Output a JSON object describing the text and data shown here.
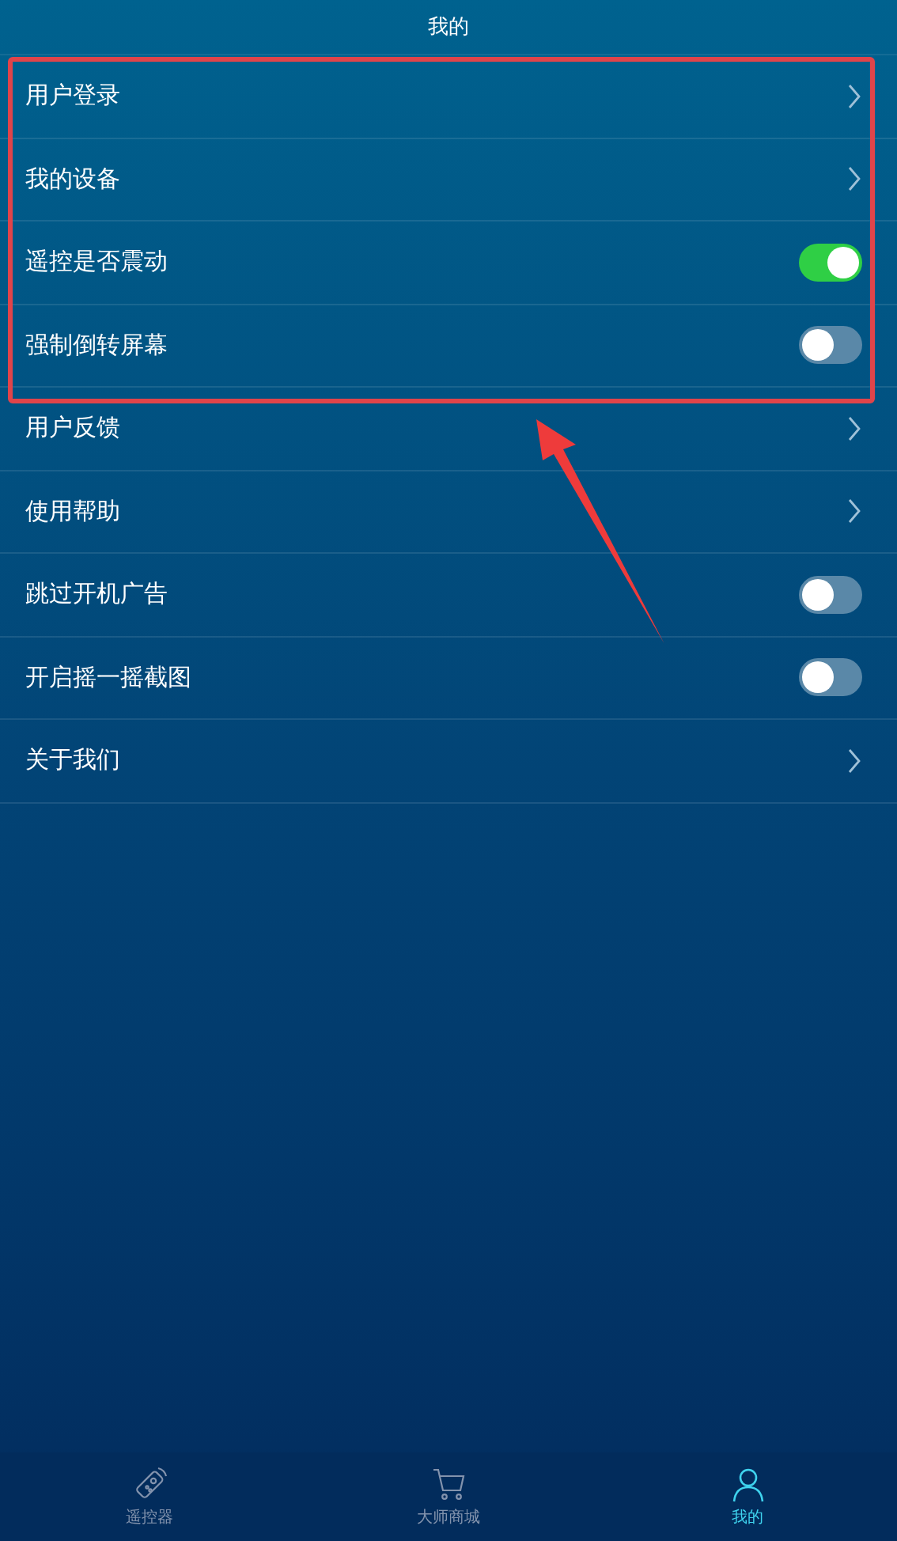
{
  "header": {
    "title": "我的"
  },
  "settings": [
    {
      "label": "用户登录",
      "kind": "link"
    },
    {
      "label": "我的设备",
      "kind": "link"
    },
    {
      "label": "遥控是否震动",
      "kind": "toggle",
      "on": true
    },
    {
      "label": "强制倒转屏幕",
      "kind": "toggle",
      "on": false
    },
    {
      "label": "用户反馈",
      "kind": "link"
    },
    {
      "label": "使用帮助",
      "kind": "link"
    },
    {
      "label": "跳过开机广告",
      "kind": "toggle",
      "on": false
    },
    {
      "label": "开启摇一摇截图",
      "kind": "toggle",
      "on": false
    },
    {
      "label": "关于我们",
      "kind": "link"
    }
  ],
  "nav": [
    {
      "label": "遥控器",
      "kind": "remote",
      "selected": false
    },
    {
      "label": "大师商城",
      "kind": "cart",
      "selected": false
    },
    {
      "label": "我的",
      "kind": "person",
      "selected": true
    }
  ]
}
